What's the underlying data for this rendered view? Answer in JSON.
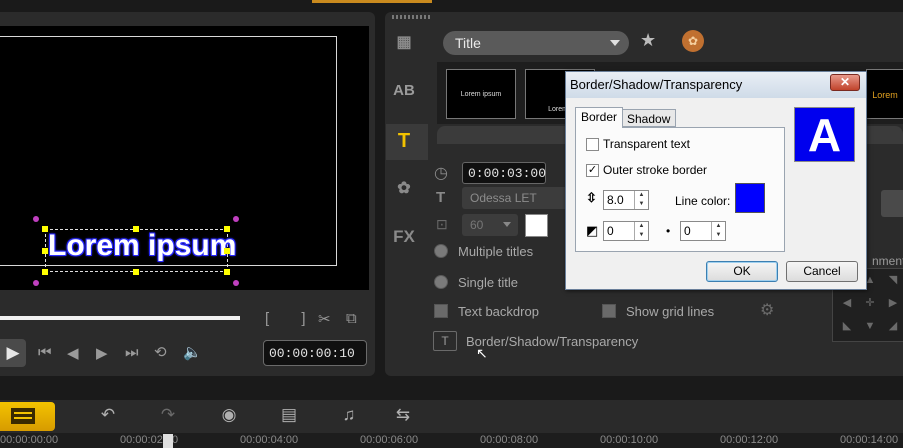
{
  "preview": {
    "title_text": "Lorem ipsum",
    "timecode": "00:00:00:10",
    "brackets": "[   ]"
  },
  "options": {
    "category": "Title",
    "thumbnails": [
      "Lorem ipsum",
      "Lorem I",
      "",
      "",
      "",
      "",
      "Lorem"
    ],
    "duration": "0:00:03:00",
    "font": "Odessa LET",
    "font_size": "60",
    "multiple_titles_label": "Multiple titles",
    "single_title_label": "Single title",
    "text_backdrop_label": "Text backdrop",
    "show_grid_lines_label": "Show grid lines",
    "border_shadow_label": "Border/Shadow/Transparency",
    "alignment_label": "nment",
    "side_icons": [
      "video-icon",
      "ab-icon",
      "title-t-icon",
      "graphic-icon",
      "fx-icon"
    ]
  },
  "dialog": {
    "title": "Border/Shadow/Transparency",
    "close": "✕",
    "tabs": {
      "border": "Border",
      "shadow": "Shadow"
    },
    "transparent_text_label": "Transparent text",
    "transparent_text_checked": false,
    "outer_stroke_label": "Outer stroke border",
    "outer_stroke_checked": true,
    "border_width": "8.0",
    "line_color_label": "Line color:",
    "line_color": "#0000ff",
    "corner_value": "0",
    "dot_value": "0",
    "preview_letter": "A",
    "ok_label": "OK",
    "cancel_label": "Cancel"
  },
  "timeline": {
    "ticks": [
      "00:00:00:00",
      "00:00:02:00",
      "00:00:04:00",
      "00:00:06:00",
      "00:00:08:00",
      "00:00:10:00",
      "00:00:12:00",
      "00:00:14:00"
    ]
  }
}
